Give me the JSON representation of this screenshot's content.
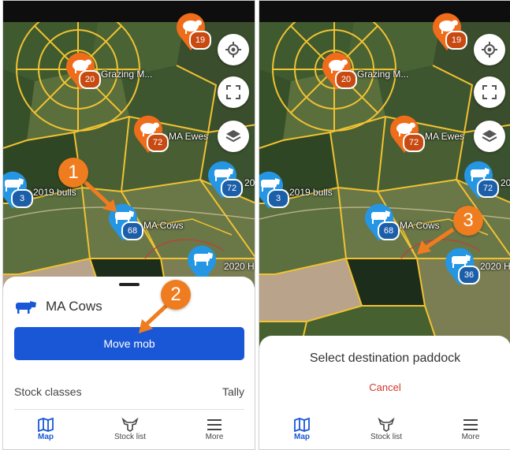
{
  "colors": {
    "accent": "#1a57d6",
    "cancel": "#d9342b",
    "step_badge": "#ef7d1f",
    "sheep_pin": "#ef6c1a",
    "cattle_pin": "#2496e3",
    "fence": "#f1c232"
  },
  "left": {
    "map_labels": {
      "grazing": "Grazing M...",
      "ma_ewes": "MA Ewes",
      "bulls": "2019 bulls",
      "ma_cows": "MA Cows",
      "heifers": "2020 H",
      "edge_label": "20"
    },
    "counts": {
      "top": "19",
      "grazing": "20",
      "ma_ewes": "72",
      "bulls": "3",
      "ma_cows": "68",
      "right_cattle": "72"
    },
    "steps": {
      "one": "1",
      "two": "2"
    },
    "sheet": {
      "mob_name": "MA Cows",
      "move_button": "Move mob",
      "stock_classes": "Stock classes",
      "tally": "Tally"
    }
  },
  "right": {
    "map_labels": {
      "grazing": "Grazing M...",
      "ma_ewes": "MA Ewes",
      "bulls": "2019 bulls",
      "ma_cows": "MA Cows",
      "heifers": "2020 H",
      "edge_label": "20"
    },
    "counts": {
      "top": "19",
      "grazing": "20",
      "ma_ewes": "72",
      "bulls": "3",
      "ma_cows": "68",
      "right_cattle": "72",
      "moved": "36"
    },
    "steps": {
      "three": "3"
    },
    "sheet": {
      "title": "Select destination paddock",
      "cancel": "Cancel"
    }
  },
  "tabs": {
    "map": "Map",
    "stock_list": "Stock list",
    "more": "More"
  },
  "icons": {
    "locate": "crosshair-icon",
    "fullscreen": "fullscreen-icon",
    "layers": "layers-icon",
    "map": "map-icon",
    "stock": "cow-head-icon",
    "more": "menu-icon"
  }
}
